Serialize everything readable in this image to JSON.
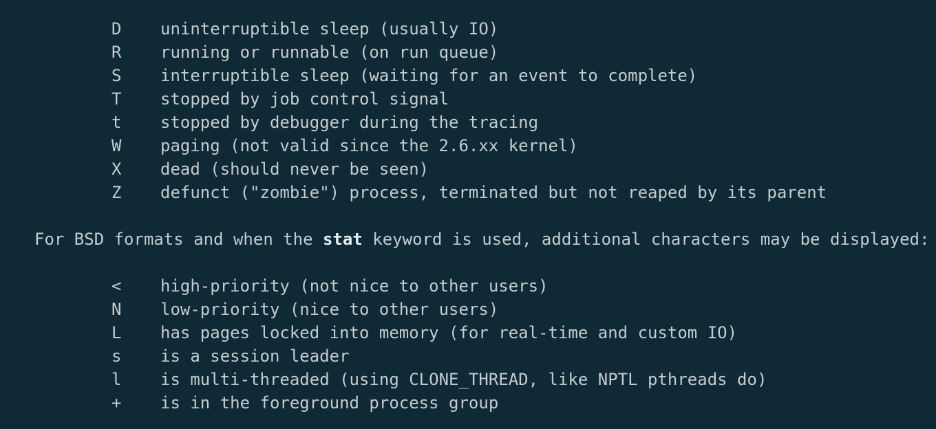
{
  "process_states": [
    {
      "code": "D",
      "desc": "uninterruptible sleep (usually IO)"
    },
    {
      "code": "R",
      "desc": "running or runnable (on run queue)"
    },
    {
      "code": "S",
      "desc": "interruptible sleep (waiting for an event to complete)"
    },
    {
      "code": "T",
      "desc": "stopped by job control signal"
    },
    {
      "code": "t",
      "desc": "stopped by debugger during the tracing"
    },
    {
      "code": "W",
      "desc": "paging (not valid since the 2.6.xx kernel)"
    },
    {
      "code": "X",
      "desc": "dead (should never be seen)"
    },
    {
      "code": "Z",
      "desc": "defunct (\"zombie\") process, terminated but not reaped by its parent"
    }
  ],
  "bsd_intro": {
    "before": "For BSD formats and when the ",
    "keyword": "stat",
    "after": " keyword is used, additional characters may be displayed:"
  },
  "bsd_flags": [
    {
      "code": "<",
      "desc": "high-priority (not nice to other users)"
    },
    {
      "code": "N",
      "desc": "low-priority (nice to other users)"
    },
    {
      "code": "L",
      "desc": "has pages locked into memory (for real-time and custom IO)"
    },
    {
      "code": "s",
      "desc": "is a session leader"
    },
    {
      "code": "l",
      "desc": "is multi-threaded (using CLONE_THREAD, like NPTL pthreads do)"
    },
    {
      "code": "+",
      "desc": "is in the foreground process group"
    }
  ]
}
